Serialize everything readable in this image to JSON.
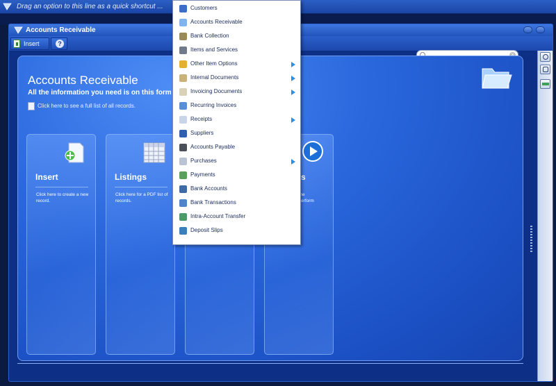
{
  "shortcut_bar": {
    "text": "Drag an option to this line as a quick shortcut ..."
  },
  "window": {
    "title": "Accounts Receivable",
    "toolbar": {
      "insert_label": "Insert",
      "help_label": "?"
    }
  },
  "content": {
    "title": "Accounts Receivable",
    "subtitle": "All the information you need is on this form",
    "list_link": "Click here to see a full list of all records.",
    "cards": [
      {
        "title": "Insert",
        "desc": "Click here to create a new record."
      },
      {
        "title": "Listings",
        "desc": "Click here for a PDF list of records."
      },
      {
        "title": "s",
        "desc": "e the\nn perform"
      }
    ]
  },
  "menu": {
    "items": [
      {
        "label": "Customers",
        "icon": "customer-icon",
        "submenu": false
      },
      {
        "label": "Accounts Receivable",
        "icon": "folder-icon",
        "submenu": false
      },
      {
        "label": "Bank Collection",
        "icon": "bank-collection-icon",
        "submenu": false
      },
      {
        "label": "Items and Services",
        "icon": "items-icon",
        "submenu": false
      },
      {
        "label": "Other Item Options",
        "icon": "options-icon",
        "submenu": true
      },
      {
        "label": "Internal Documents",
        "icon": "document-icon",
        "submenu": true
      },
      {
        "label": "Invoicing Documents",
        "icon": "invoice-icon",
        "submenu": true
      },
      {
        "label": "Recurring Invoices",
        "icon": "recurring-icon",
        "submenu": false
      },
      {
        "label": "Receipts",
        "icon": "receipt-icon",
        "submenu": true
      },
      {
        "label": "Suppliers",
        "icon": "supplier-icon",
        "submenu": false
      },
      {
        "label": "Accounts Payable",
        "icon": "folder-dark-icon",
        "submenu": false
      },
      {
        "label": "Purchases",
        "icon": "purchase-icon",
        "submenu": true
      },
      {
        "label": "Payments",
        "icon": "payment-icon",
        "submenu": false
      },
      {
        "label": "Bank Accounts",
        "icon": "bank-icon",
        "submenu": false
      },
      {
        "label": "Bank Transactions",
        "icon": "transaction-icon",
        "submenu": false
      },
      {
        "label": "Intra-Account Transfer",
        "icon": "transfer-icon",
        "submenu": false
      },
      {
        "label": "Deposit Slips",
        "icon": "deposit-icon",
        "submenu": false
      }
    ]
  },
  "colors": {
    "accent": "#2a67dd",
    "menu_arrow": "#2c8fe0",
    "menu_text": "#1a2b5c"
  }
}
